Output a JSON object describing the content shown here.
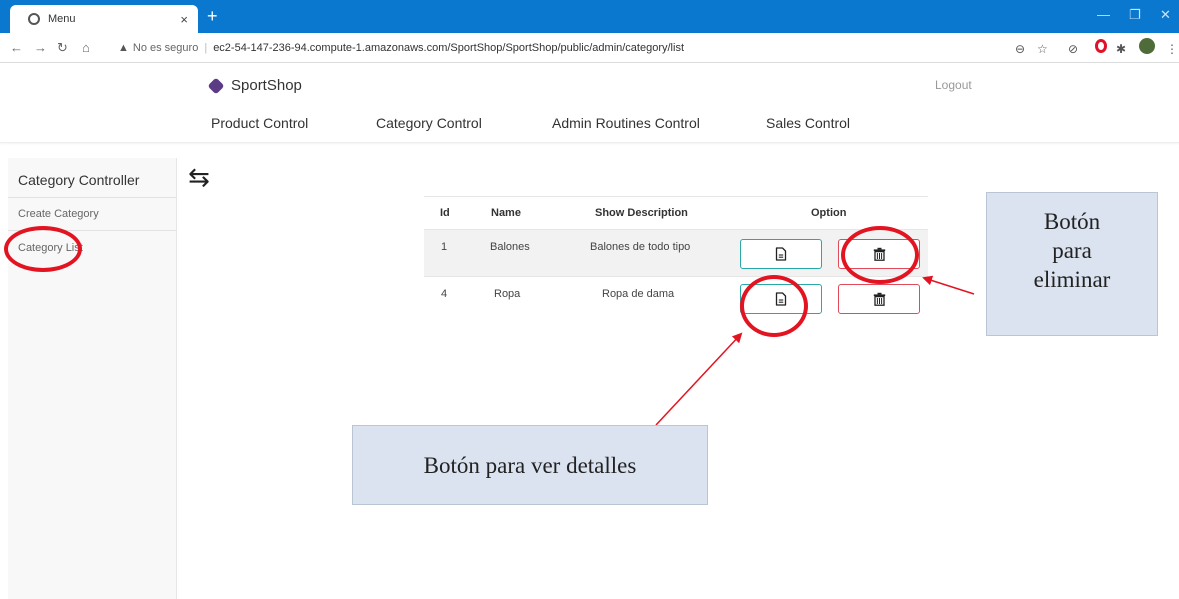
{
  "browser": {
    "tab_title": "Menu",
    "tab_close": "×",
    "new_tab": "+",
    "security_label": "No es seguro",
    "url": "ec2-54-147-236-94.compute-1.amazonaws.com/SportShop/SportShop/public/admin/category/list"
  },
  "header": {
    "brand": "SportShop",
    "logout": "Logout",
    "nav": [
      {
        "label": "Product Control"
      },
      {
        "label": "Category Control"
      },
      {
        "label": "Admin Routines Control"
      },
      {
        "label": "Sales Control"
      }
    ]
  },
  "sidebar": {
    "title": "Category Controller",
    "items": [
      {
        "label": "Create Category"
      },
      {
        "label": "Category List"
      }
    ],
    "toggle": "⇆"
  },
  "table": {
    "headers": [
      "Id",
      "Name",
      "Show Description",
      "Option"
    ],
    "rows": [
      {
        "id": "1",
        "name": "Balones",
        "description": "Balones de todo tipo"
      },
      {
        "id": "4",
        "name": "Ropa",
        "description": "Ropa de dama"
      }
    ]
  },
  "annotations": {
    "delete_callout": [
      "Botón",
      "para",
      "eliminar"
    ],
    "details_callout": "Botón para ver detalles"
  },
  "colors": {
    "tabbar": "#0b78d0",
    "view_border": "#2aa8a8",
    "delete_border": "#e04a5a",
    "annotation_red": "#e31421",
    "callout_bg": "#dae3ef"
  }
}
